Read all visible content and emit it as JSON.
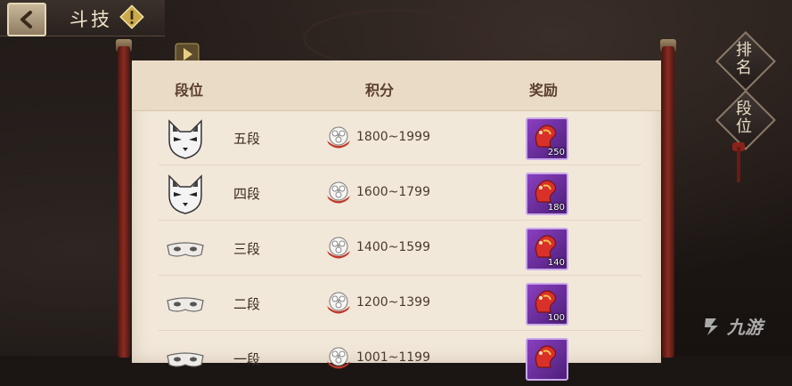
{
  "header": {
    "title": "斗技"
  },
  "side_buttons": [
    {
      "label": "排名",
      "chars": [
        "排",
        "名"
      ]
    },
    {
      "label": "段位",
      "chars": [
        "段",
        "位"
      ]
    }
  ],
  "table": {
    "columns": [
      "段位",
      "积分",
      "奖励"
    ],
    "rows": [
      {
        "rank": "五段",
        "points": "1800~1999",
        "reward": "250",
        "mask_icon": "fox-mask-icon"
      },
      {
        "rank": "四段",
        "points": "1600~1799",
        "reward": "180",
        "mask_icon": "fox-mask-icon"
      },
      {
        "rank": "三段",
        "points": "1400~1599",
        "reward": "140",
        "mask_icon": "eye-mask-icon"
      },
      {
        "rank": "二段",
        "points": "1200~1399",
        "reward": "100",
        "mask_icon": "eye-mask-icon"
      },
      {
        "rank": "一段",
        "points": "1001~1199",
        "reward": "",
        "mask_icon": "eye-mask-icon"
      }
    ]
  },
  "watermark": {
    "text": "九游"
  },
  "colors": {
    "accent": "#8c2c22",
    "reward_bg": "#6a2fa0",
    "parchment": "#f2e8da"
  }
}
